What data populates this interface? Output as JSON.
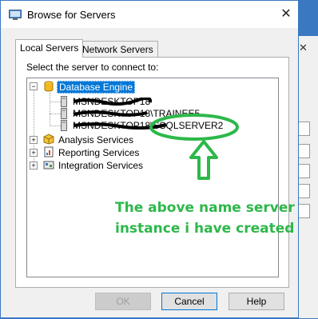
{
  "window": {
    "title": "Browse for Servers",
    "close_glyph": "✕"
  },
  "tabs": [
    {
      "label": "Local Servers",
      "active": true
    },
    {
      "label": "Network Servers",
      "active": false
    }
  ],
  "prompt": "Select the server to connect to:",
  "tree": {
    "database_engine": {
      "label": "Database Engine",
      "expander": "−",
      "icon": "database-cylinder-icon"
    },
    "instances": [
      {
        "label": "MSNDESKTOP18",
        "redacted": true
      },
      {
        "label": "MSNDESKTOP18\\TRAINEE5",
        "redacted": true
      },
      {
        "label": "MSNDESKTOP18\\SSQLSERVER2",
        "redacted": true
      }
    ],
    "others": [
      {
        "label": "Analysis Services",
        "expander": "+",
        "icon": "cube-icon"
      },
      {
        "label": "Reporting Services",
        "expander": "+",
        "icon": "report-icon"
      },
      {
        "label": "Integration Services",
        "expander": "+",
        "icon": "package-icon"
      }
    ]
  },
  "buttons": {
    "ok": "OK",
    "cancel": "Cancel",
    "help": "Help"
  },
  "annotation": {
    "line1": "The above name server",
    "line2": "instance i have created",
    "color": "#2db84a"
  },
  "colors": {
    "selection": "#0078d7",
    "accent": "#3a78c2"
  }
}
